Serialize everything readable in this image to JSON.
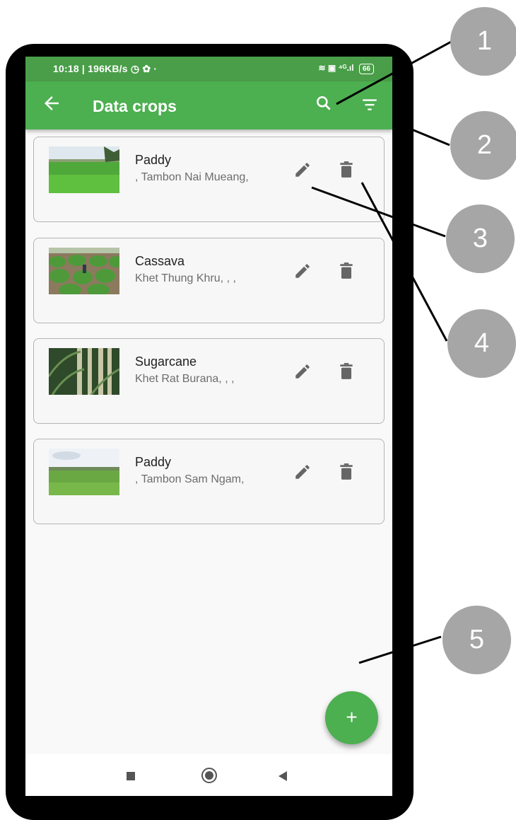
{
  "status_bar": {
    "left_text": "10:18 | 196KB/s ◷ ✿  ·",
    "right_text": "≋ ▣ ⁴ᴳ.ıl",
    "battery": "66"
  },
  "app_bar": {
    "title": "Data crops",
    "back_icon": "arrow-left-icon",
    "search_icon": "search-icon",
    "filter_icon": "filter-icon"
  },
  "crops": [
    {
      "name": "Paddy",
      "location": ", Tambon Nai Mueang,",
      "image": "paddy-field"
    },
    {
      "name": "Cassava",
      "location": "Khet Thung Khru, , ,",
      "image": "cassava-field"
    },
    {
      "name": "Sugarcane",
      "location": "Khet Rat Burana, , ,",
      "image": "sugarcane"
    },
    {
      "name": "Paddy",
      "location": ", Tambon Sam Ngam,",
      "image": "paddy-field-2"
    }
  ],
  "fab": {
    "label": "+"
  },
  "callouts": [
    "1",
    "2",
    "3",
    "4",
    "5"
  ],
  "colors": {
    "primary": "#4caf50",
    "status_bar": "#4a9e49",
    "callout": "#a6a6a6"
  }
}
